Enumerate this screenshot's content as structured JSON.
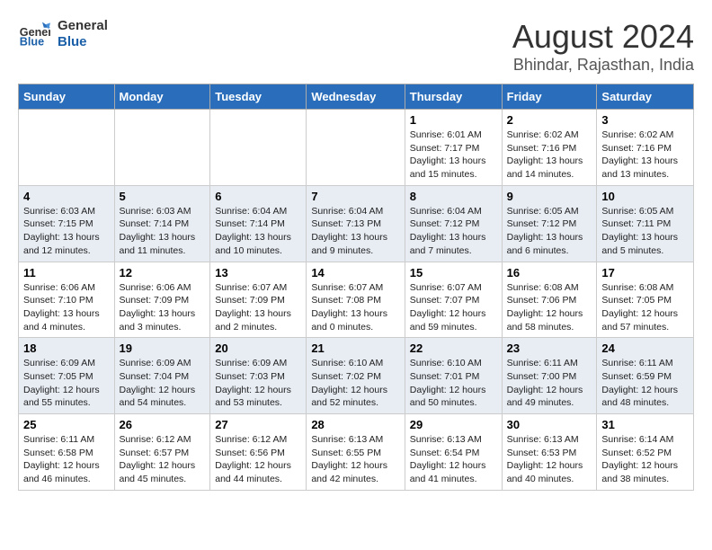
{
  "logo": {
    "line1": "General",
    "line2": "Blue"
  },
  "title": "August 2024",
  "subtitle": "Bhindar, Rajasthan, India",
  "days_of_week": [
    "Sunday",
    "Monday",
    "Tuesday",
    "Wednesday",
    "Thursday",
    "Friday",
    "Saturday"
  ],
  "weeks": [
    [
      {
        "day": "",
        "info": ""
      },
      {
        "day": "",
        "info": ""
      },
      {
        "day": "",
        "info": ""
      },
      {
        "day": "",
        "info": ""
      },
      {
        "day": "1",
        "info": "Sunrise: 6:01 AM\nSunset: 7:17 PM\nDaylight: 13 hours and 15 minutes."
      },
      {
        "day": "2",
        "info": "Sunrise: 6:02 AM\nSunset: 7:16 PM\nDaylight: 13 hours and 14 minutes."
      },
      {
        "day": "3",
        "info": "Sunrise: 6:02 AM\nSunset: 7:16 PM\nDaylight: 13 hours and 13 minutes."
      }
    ],
    [
      {
        "day": "4",
        "info": "Sunrise: 6:03 AM\nSunset: 7:15 PM\nDaylight: 13 hours and 12 minutes."
      },
      {
        "day": "5",
        "info": "Sunrise: 6:03 AM\nSunset: 7:14 PM\nDaylight: 13 hours and 11 minutes."
      },
      {
        "day": "6",
        "info": "Sunrise: 6:04 AM\nSunset: 7:14 PM\nDaylight: 13 hours and 10 minutes."
      },
      {
        "day": "7",
        "info": "Sunrise: 6:04 AM\nSunset: 7:13 PM\nDaylight: 13 hours and 9 minutes."
      },
      {
        "day": "8",
        "info": "Sunrise: 6:04 AM\nSunset: 7:12 PM\nDaylight: 13 hours and 7 minutes."
      },
      {
        "day": "9",
        "info": "Sunrise: 6:05 AM\nSunset: 7:12 PM\nDaylight: 13 hours and 6 minutes."
      },
      {
        "day": "10",
        "info": "Sunrise: 6:05 AM\nSunset: 7:11 PM\nDaylight: 13 hours and 5 minutes."
      }
    ],
    [
      {
        "day": "11",
        "info": "Sunrise: 6:06 AM\nSunset: 7:10 PM\nDaylight: 13 hours and 4 minutes."
      },
      {
        "day": "12",
        "info": "Sunrise: 6:06 AM\nSunset: 7:09 PM\nDaylight: 13 hours and 3 minutes."
      },
      {
        "day": "13",
        "info": "Sunrise: 6:07 AM\nSunset: 7:09 PM\nDaylight: 13 hours and 2 minutes."
      },
      {
        "day": "14",
        "info": "Sunrise: 6:07 AM\nSunset: 7:08 PM\nDaylight: 13 hours and 0 minutes."
      },
      {
        "day": "15",
        "info": "Sunrise: 6:07 AM\nSunset: 7:07 PM\nDaylight: 12 hours and 59 minutes."
      },
      {
        "day": "16",
        "info": "Sunrise: 6:08 AM\nSunset: 7:06 PM\nDaylight: 12 hours and 58 minutes."
      },
      {
        "day": "17",
        "info": "Sunrise: 6:08 AM\nSunset: 7:05 PM\nDaylight: 12 hours and 57 minutes."
      }
    ],
    [
      {
        "day": "18",
        "info": "Sunrise: 6:09 AM\nSunset: 7:05 PM\nDaylight: 12 hours and 55 minutes."
      },
      {
        "day": "19",
        "info": "Sunrise: 6:09 AM\nSunset: 7:04 PM\nDaylight: 12 hours and 54 minutes."
      },
      {
        "day": "20",
        "info": "Sunrise: 6:09 AM\nSunset: 7:03 PM\nDaylight: 12 hours and 53 minutes."
      },
      {
        "day": "21",
        "info": "Sunrise: 6:10 AM\nSunset: 7:02 PM\nDaylight: 12 hours and 52 minutes."
      },
      {
        "day": "22",
        "info": "Sunrise: 6:10 AM\nSunset: 7:01 PM\nDaylight: 12 hours and 50 minutes."
      },
      {
        "day": "23",
        "info": "Sunrise: 6:11 AM\nSunset: 7:00 PM\nDaylight: 12 hours and 49 minutes."
      },
      {
        "day": "24",
        "info": "Sunrise: 6:11 AM\nSunset: 6:59 PM\nDaylight: 12 hours and 48 minutes."
      }
    ],
    [
      {
        "day": "25",
        "info": "Sunrise: 6:11 AM\nSunset: 6:58 PM\nDaylight: 12 hours and 46 minutes."
      },
      {
        "day": "26",
        "info": "Sunrise: 6:12 AM\nSunset: 6:57 PM\nDaylight: 12 hours and 45 minutes."
      },
      {
        "day": "27",
        "info": "Sunrise: 6:12 AM\nSunset: 6:56 PM\nDaylight: 12 hours and 44 minutes."
      },
      {
        "day": "28",
        "info": "Sunrise: 6:13 AM\nSunset: 6:55 PM\nDaylight: 12 hours and 42 minutes."
      },
      {
        "day": "29",
        "info": "Sunrise: 6:13 AM\nSunset: 6:54 PM\nDaylight: 12 hours and 41 minutes."
      },
      {
        "day": "30",
        "info": "Sunrise: 6:13 AM\nSunset: 6:53 PM\nDaylight: 12 hours and 40 minutes."
      },
      {
        "day": "31",
        "info": "Sunrise: 6:14 AM\nSunset: 6:52 PM\nDaylight: 12 hours and 38 minutes."
      }
    ]
  ]
}
